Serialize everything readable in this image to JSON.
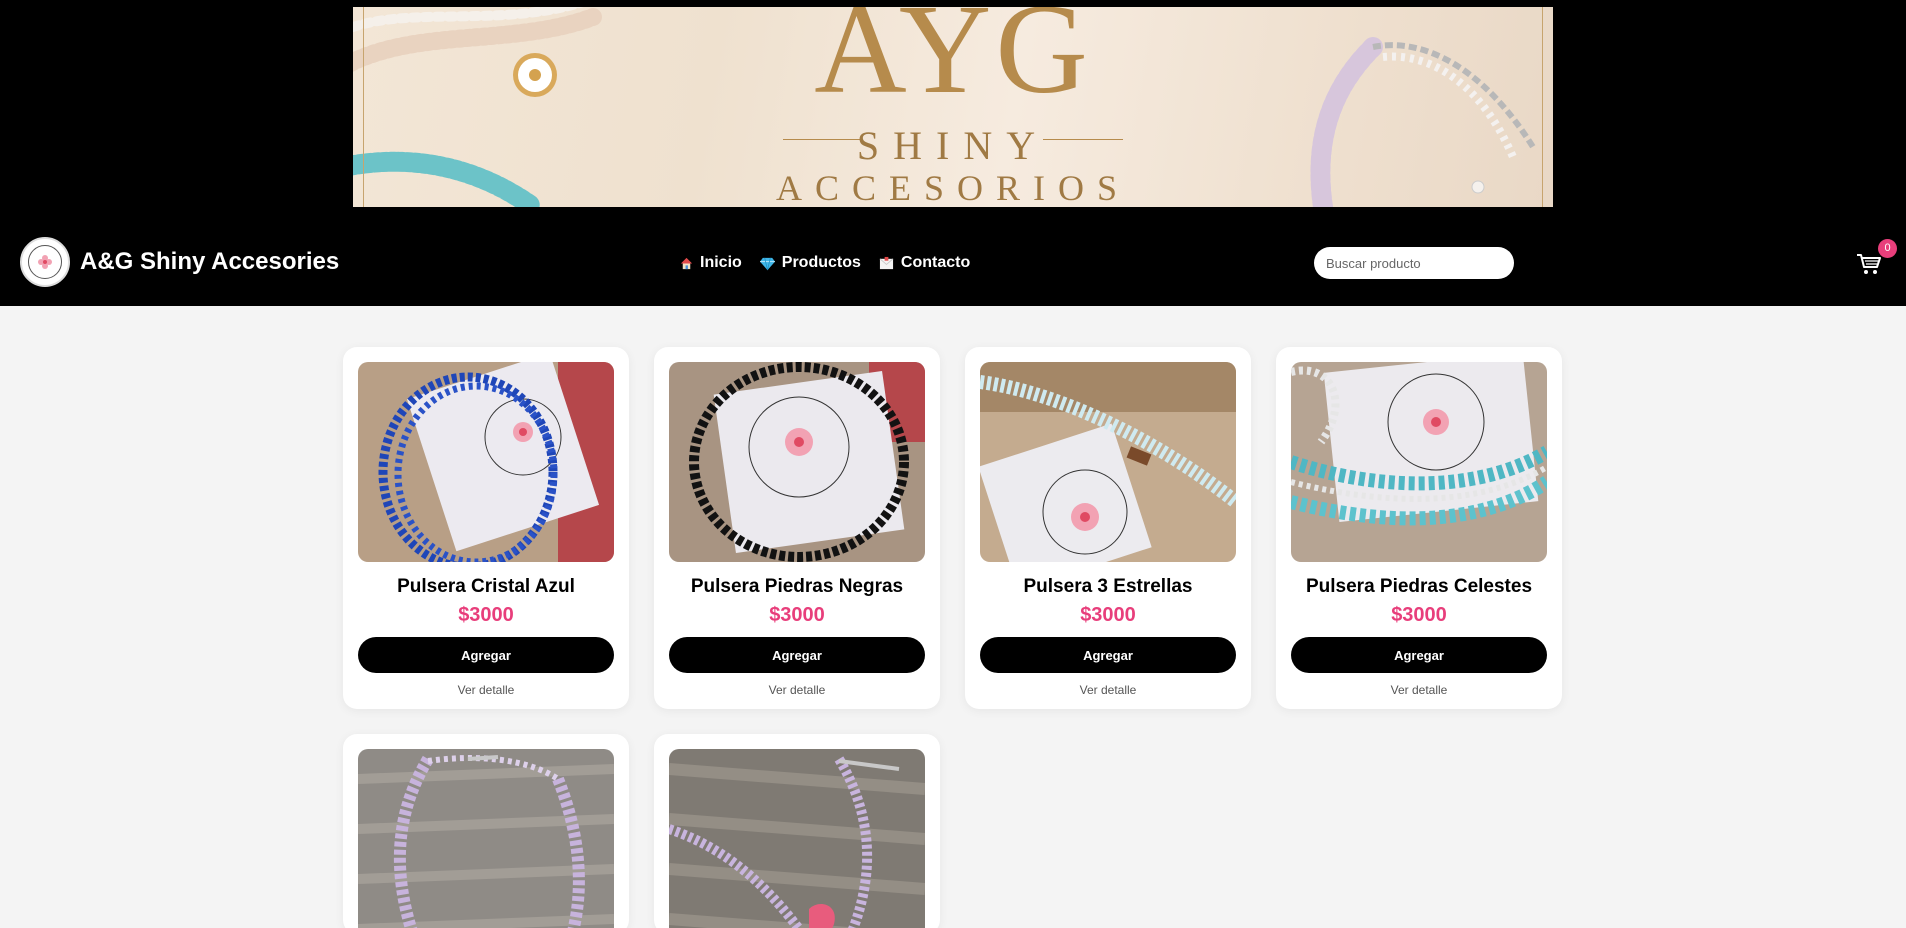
{
  "banner": {
    "title": "AYG",
    "line1": "SHINY",
    "line2": "ACCESORIOS"
  },
  "header": {
    "brand": "A&G Shiny Accesories",
    "nav": [
      {
        "label": "Inicio",
        "icon": "house-icon"
      },
      {
        "label": "Productos",
        "icon": "gem-icon"
      },
      {
        "label": "Contacto",
        "icon": "envelope-icon"
      }
    ],
    "search_placeholder": "Buscar producto",
    "cart_count": "0"
  },
  "products": [
    {
      "name": "Pulsera Cristal Azul",
      "price": "$3000",
      "button": "Agregar",
      "link": "Ver detalle",
      "bead_color": "#1f46b8"
    },
    {
      "name": "Pulsera Piedras Negras",
      "price": "$3000",
      "button": "Agregar",
      "link": "Ver detalle",
      "bead_color": "#151515"
    },
    {
      "name": "Pulsera 3 Estrellas",
      "price": "$3000",
      "button": "Agregar",
      "link": "Ver detalle",
      "bead_color": "#bfe4ec"
    },
    {
      "name": "Pulsera Piedras Celestes",
      "price": "$3000",
      "button": "Agregar",
      "link": "Ver detalle",
      "bead_color": "#4fb7c4"
    }
  ],
  "colors": {
    "accent": "#e83e7b",
    "nav_bg": "#000000",
    "page_bg": "#f4f4f4"
  }
}
